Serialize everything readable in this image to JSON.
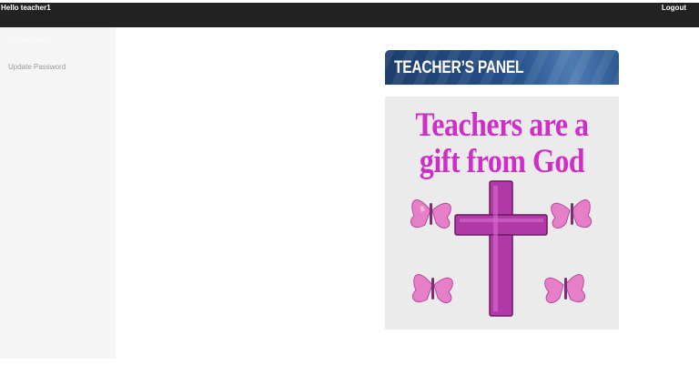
{
  "header": {
    "greeting": "Hello teacher1",
    "logout_label": "Logout"
  },
  "sidebar": {
    "items": [
      {
        "label": "Upload Marks",
        "active": true
      },
      {
        "label": "Update Password",
        "active": false
      }
    ]
  },
  "main": {
    "banner_title": "TEACHER’S PANEL",
    "poster": {
      "line1": "Teachers are a",
      "line2": "gift from God"
    }
  },
  "colors": {
    "topbar": "#222222",
    "sidebar": "#f5f5f5",
    "poster_text": "#cf2ec6",
    "cross": "#b03aa7"
  }
}
